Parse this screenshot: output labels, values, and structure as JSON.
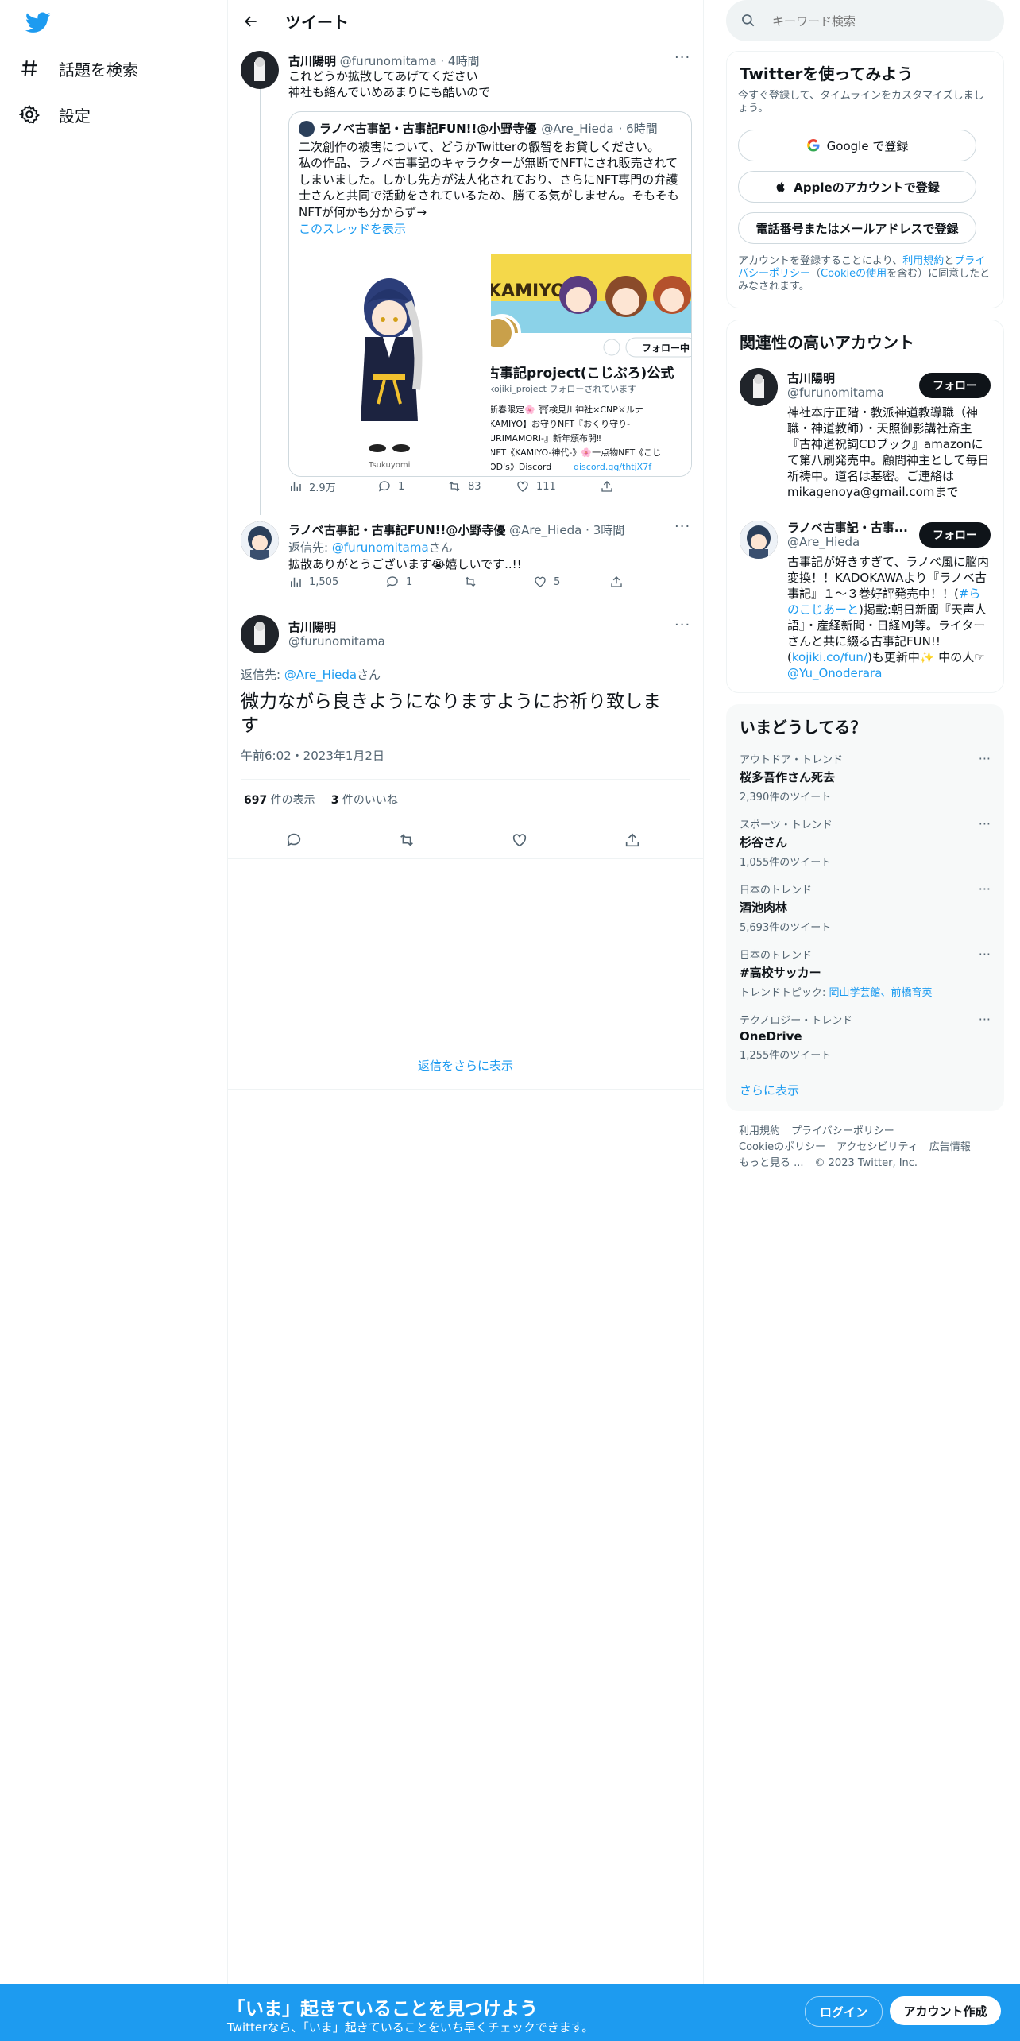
{
  "nav": {
    "explore_label": "話題を検索",
    "settings_label": "設定"
  },
  "header": {
    "title": "ツイート"
  },
  "tweet1": {
    "name": "古川陽明",
    "handle": "@furunomitama",
    "time": "· 4時間",
    "line1": "これどうか拡散してあげてください",
    "line2": "神社も絡んでいめあまりにも酷いので",
    "quote": {
      "name": "ラノベ古事記・古事記FUN!!@小野寺優",
      "handle": "@Are_Hieda",
      "time": "· 6時間",
      "line1": "二次創作の被害について、どうかTwitterの叡智をお貸しください。",
      "line2": "私の作品、ラノベ古事記のキャラクターが無断でNFTにされ販売されて",
      "line3": "しまいました。しかし先方が法人化されており、さらにNFT専門の弁護",
      "line4": "士さんと共同で活動をされているため、勝てる気がしません。そもそも",
      "line5": "NFTが何かも分からず→",
      "show_thread": "このスレッドを表示",
      "image1_caption": "Tsukuyomi",
      "image2": {
        "banner": "KAMIYO",
        "follow_label": "フォロー中",
        "title": "古事記project(こじぷろ)公式",
        "sub": "kojiki_project  フォローされています",
        "b1": "新春限定🌸 ⛩検見川神社×CNP⚔ルナ",
        "b2": "KAMIYO】お守りNFT『おくり守り-",
        "b3": "URIMAMORI-』新年頒布開‼",
        "b4": "NFT《KAMIYO-神代-》🌸一点物NFT《こじ",
        "b5": "OD's》Discord",
        "b5_link": "discord.gg/thtjX7f"
      }
    },
    "views": "2.9万",
    "replies": "1",
    "retweets": "83",
    "likes": "111"
  },
  "tweet2": {
    "name": "ラノベ古事記・古事記FUN!!@小野寺優",
    "handle": "@Are_Hieda",
    "time": "· 3時間",
    "reply_prefix": "返信先:",
    "reply_to": "@furunomitama",
    "reply_suffix": "さん",
    "text": "拡散ありがとうございます😭嬉しいです..!!",
    "views": "1,505",
    "replies": "1",
    "likes": "5"
  },
  "main_tweet": {
    "name": "古川陽明",
    "handle": "@furunomitama",
    "reply_prefix": "返信先:",
    "reply_to": "@Are_Hieda",
    "reply_suffix": "さん",
    "line1": "微力ながら良きようになりますようにお祈り致しま",
    "line2": "す",
    "timestamp": "午前6:02・2023年1月2日",
    "views_count": "697",
    "views_label": "件の表示",
    "likes_count": "3",
    "likes_label": "件のいいね",
    "more_replies": "返信をさらに表示"
  },
  "search": {
    "placeholder": "キーワード検索"
  },
  "signup_card": {
    "title": "Twitterを使ってみよう",
    "subtitle1": "今すぐ登録して、タイムラインをカスタマイズしまし",
    "subtitle2": "ょう。",
    "google_label": "Google で登録",
    "apple_label": "Appleのアカウントで登録",
    "phone_label": "電話番号またはメールアドレスで登録",
    "legal_pre": "アカウントを登録することにより、",
    "terms": "利用規約",
    "and": "と",
    "privacy": "プライバシーポリシー",
    "cookie_pre": "（",
    "cookie": "Cookieの使用",
    "legal_post": "を含む）に同意したとみなされます。"
  },
  "related": {
    "title": "関連性の高いアカウント",
    "follow_label": "フォロー",
    "accounts": [
      {
        "name": "古川陽明",
        "handle": "@furunomitama",
        "bio": "神社本庁正階・教派神道教導職（神職・神道教師）・天照御影講社斎主『古神道祝詞CDブック』amazonにて第八刷発売中。顧問神主として毎日祈祷中。道名は基密。ご連絡はmikagenoya@gmail.comまで"
      },
      {
        "name": "ラノベ古事記・古事...",
        "handle": "@Are_Hieda",
        "bio1": "古事記が好きすぎて、ラノベ風に脳内変換！！KADOKAWAより『ラノベ古事記』１〜３巻好評発売中！！(",
        "bio_link1": "#らのこじあーと",
        "bio2": ")掲載:朝日新聞『天声人語』・産経新聞・日経MJ等。ライターさんと共に綴る古事記FUN!!(",
        "bio_link2": "kojiki.co/fun/",
        "bio3": ")も更新中✨ 中の人☞",
        "bio_link3": "@Yu_Onoderara"
      }
    ]
  },
  "trends": {
    "title": "いまどうしてる？",
    "items": [
      {
        "category": "アウトドア・トレンド",
        "name": "桜多吾作さん死去",
        "count": "2,390件のツイート"
      },
      {
        "category": "スポーツ・トレンド",
        "name": "杉谷さん",
        "count": "1,055件のツイート"
      },
      {
        "category": "日本のトレンド",
        "name": "酒池肉林",
        "count": "5,693件のツイート"
      },
      {
        "category": "日本のトレンド",
        "name": "#高校サッカー",
        "topic_label": "トレンドトピック:",
        "topic": "岡山学芸館、前橋育英"
      },
      {
        "category": "テクノロジー・トレンド",
        "name": "OneDrive",
        "count": "1,255件のツイート"
      }
    ],
    "show_more": "さらに表示"
  },
  "footer": {
    "terms": "利用規約",
    "privacy": "プライバシーポリシー",
    "cookie": "Cookieのポリシー",
    "accessibility": "アクセシビリティ",
    "ads": "広告情報",
    "more": "もっと見る ...",
    "copyright": "© 2023 Twitter, Inc."
  },
  "bottom_bar": {
    "title": "「いま」起きていることを見つけよう",
    "subtitle": "Twitterなら、「いま」起きていることをいち早くチェックできます。",
    "login": "ログイン",
    "signup": "アカウント作成"
  },
  "colors": {
    "accent": "#1d9bf0",
    "text": "#0f1419",
    "muted": "#536471",
    "border": "#eff3f4"
  }
}
